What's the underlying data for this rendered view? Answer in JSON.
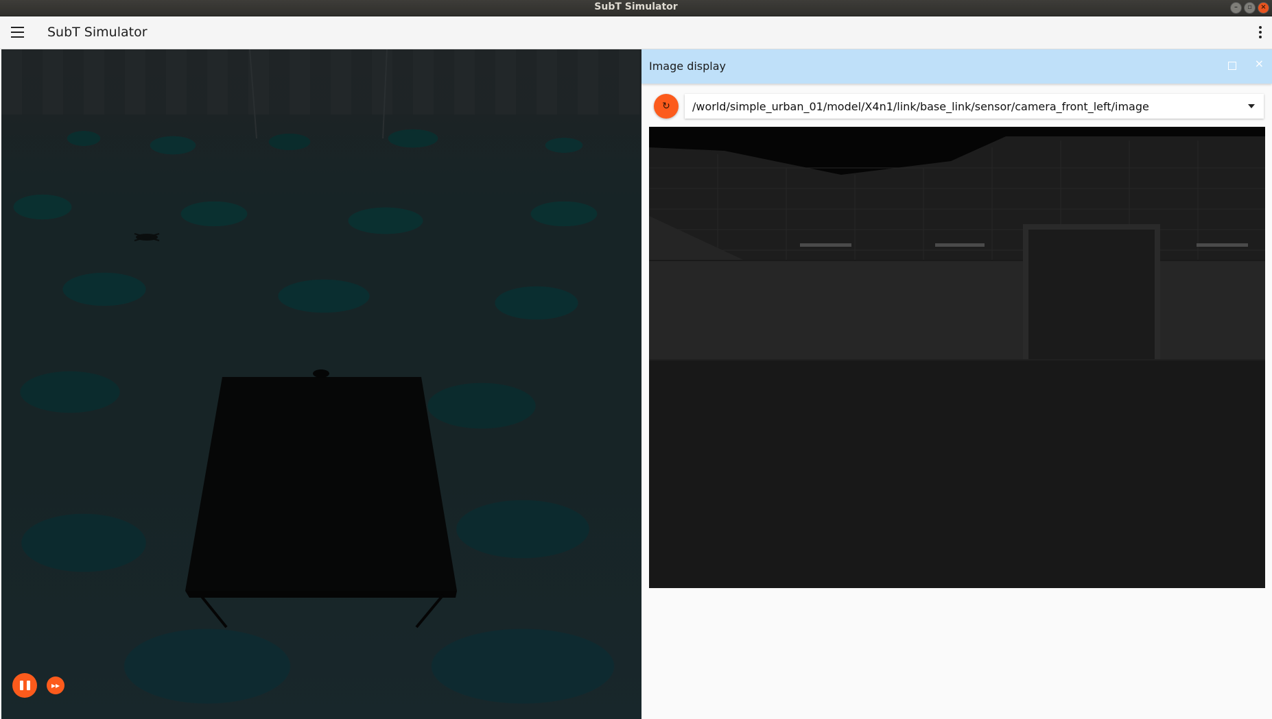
{
  "window": {
    "title": "SubT Simulator",
    "controls": [
      "minimize-icon",
      "maximize-icon",
      "close-icon"
    ]
  },
  "toolbar": {
    "menu_icon": "hamburger-menu-icon",
    "title": "SubT Simulator",
    "overflow_icon": "more-vertical-icon"
  },
  "scene": {
    "playback": {
      "pause_icon": "pause-icon",
      "step_icon": "fast-forward-icon"
    }
  },
  "image_display": {
    "title": "Image display",
    "maximize_icon": "maximize-icon",
    "close_icon": "close-icon",
    "refresh_icon": "refresh-icon",
    "selected_topic": "/world/simple_urban_01/model/X4n1/link/base_link/sensor/camera_front_left/image",
    "dropdown_icon": "chevron-down-icon"
  },
  "colors": {
    "accent": "#fc5b1c",
    "panel_header": "#bfe0f9",
    "toolbar": "#f5f5f5",
    "os_titlebar": "#353431"
  }
}
